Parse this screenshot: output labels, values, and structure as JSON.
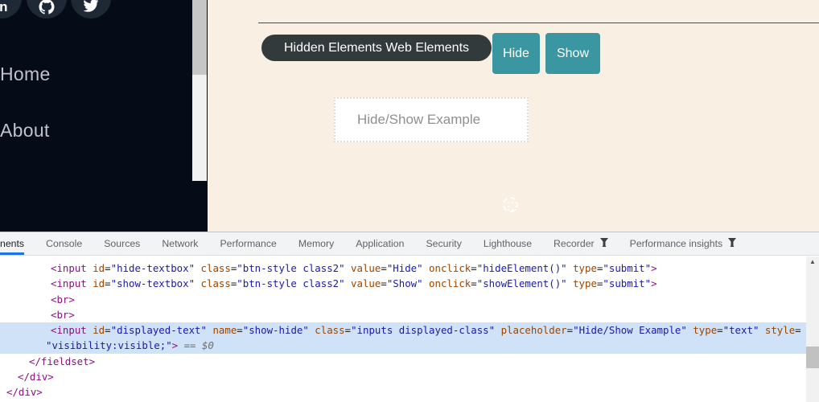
{
  "sidebar": {
    "social": [
      {
        "name": "linkedin"
      },
      {
        "name": "github"
      },
      {
        "name": "twitter"
      }
    ],
    "links": [
      {
        "label": "Home"
      },
      {
        "label": "About"
      }
    ]
  },
  "content": {
    "tooltip": "Hidden Elements Web Elements",
    "hide_button": "Hide",
    "show_button": "Show",
    "input_placeholder": "Hide/Show Example"
  },
  "devtools": {
    "tabs": [
      {
        "label": "nents",
        "selected": true
      },
      {
        "label": "Console"
      },
      {
        "label": "Sources"
      },
      {
        "label": "Network"
      },
      {
        "label": "Performance"
      },
      {
        "label": "Memory"
      },
      {
        "label": "Application"
      },
      {
        "label": "Security"
      },
      {
        "label": "Lighthouse"
      },
      {
        "label": "Recorder",
        "flask": true
      },
      {
        "label": "Performance insights",
        "flask": true
      }
    ],
    "scroll_arrow": "▲",
    "code": {
      "lines": [
        {
          "indent": 63,
          "hl": false,
          "tokens": [
            [
              "tag",
              "<input"
            ],
            [
              "attr",
              " id"
            ],
            [
              "eq",
              "="
            ],
            [
              "val",
              "\"hide-textbox\""
            ],
            [
              "attr",
              " class"
            ],
            [
              "eq",
              "="
            ],
            [
              "val",
              "\"btn-style class2\""
            ],
            [
              "attr",
              " value"
            ],
            [
              "eq",
              "="
            ],
            [
              "val",
              "\"Hide\""
            ],
            [
              "attr",
              " onclick"
            ],
            [
              "eq",
              "="
            ],
            [
              "val",
              "\"hideElement()\""
            ],
            [
              "attr",
              " type"
            ],
            [
              "eq",
              "="
            ],
            [
              "val",
              "\"submit\""
            ],
            [
              "tag",
              ">"
            ]
          ]
        },
        {
          "indent": 63,
          "hl": false,
          "tokens": [
            [
              "tag",
              "<input"
            ],
            [
              "attr",
              " id"
            ],
            [
              "eq",
              "="
            ],
            [
              "val",
              "\"show-textbox\""
            ],
            [
              "attr",
              " class"
            ],
            [
              "eq",
              "="
            ],
            [
              "val",
              "\"btn-style class2\""
            ],
            [
              "attr",
              " value"
            ],
            [
              "eq",
              "="
            ],
            [
              "val",
              "\"Show\""
            ],
            [
              "attr",
              " onclick"
            ],
            [
              "eq",
              "="
            ],
            [
              "val",
              "\"showElement()\""
            ],
            [
              "attr",
              " type"
            ],
            [
              "eq",
              "="
            ],
            [
              "val",
              "\"submit\""
            ],
            [
              "tag",
              ">"
            ]
          ]
        },
        {
          "indent": 63,
          "hl": false,
          "tokens": [
            [
              "tag",
              "<br>"
            ]
          ]
        },
        {
          "indent": 63,
          "hl": false,
          "tokens": [
            [
              "tag",
              "<br>"
            ]
          ]
        },
        {
          "indent": 63,
          "hl": true,
          "tokens": [
            [
              "tag",
              "<input"
            ],
            [
              "attr",
              " id"
            ],
            [
              "eq",
              "="
            ],
            [
              "val",
              "\"displayed-text\""
            ],
            [
              "attr",
              " name"
            ],
            [
              "eq",
              "="
            ],
            [
              "val",
              "\"show-hide\""
            ],
            [
              "attr",
              " class"
            ],
            [
              "eq",
              "="
            ],
            [
              "val",
              "\"inputs displayed-class\""
            ],
            [
              "attr",
              " placeholder"
            ],
            [
              "eq",
              "="
            ],
            [
              "val",
              "\"Hide/Show Example\""
            ],
            [
              "attr",
              " type"
            ],
            [
              "eq",
              "="
            ],
            [
              "val",
              "\"text\""
            ],
            [
              "attr",
              " style"
            ],
            [
              "eq",
              "="
            ]
          ]
        },
        {
          "indent": 57,
          "hl": true,
          "tokens": [
            [
              "val",
              "\"visibility:visible;\""
            ],
            [
              "tag",
              ">"
            ],
            [
              "meta",
              " == $0"
            ]
          ]
        },
        {
          "indent": 36,
          "hl": false,
          "tokens": [
            [
              "tag",
              "</fieldset>"
            ]
          ]
        },
        {
          "indent": 22,
          "hl": false,
          "tokens": [
            [
              "tag",
              "</div>"
            ]
          ]
        },
        {
          "indent": 8,
          "hl": false,
          "tokens": [
            [
              "tag",
              "</div>"
            ]
          ]
        }
      ]
    }
  },
  "colors": {
    "sidebar-bg": "#050b17",
    "social-circle": "#1f2835",
    "link-text": "#c2c1ce",
    "cream": "#f9efe3",
    "tooltip-bg": "#333a3c",
    "accent-teal": "#3a96a0",
    "placeholder": "#8f8f8f",
    "tab-text": "#5f6368",
    "tab-underline": "#1a73e8",
    "tabbar-bg": "#f1f3f4",
    "code-tag": "#881280",
    "code-attr": "#994500",
    "code-val": "#1a1aa6",
    "highlight": "#cfe2f8",
    "scroll-thumb": "#c1c1c1",
    "scroll-track": "#f1f1f1"
  }
}
